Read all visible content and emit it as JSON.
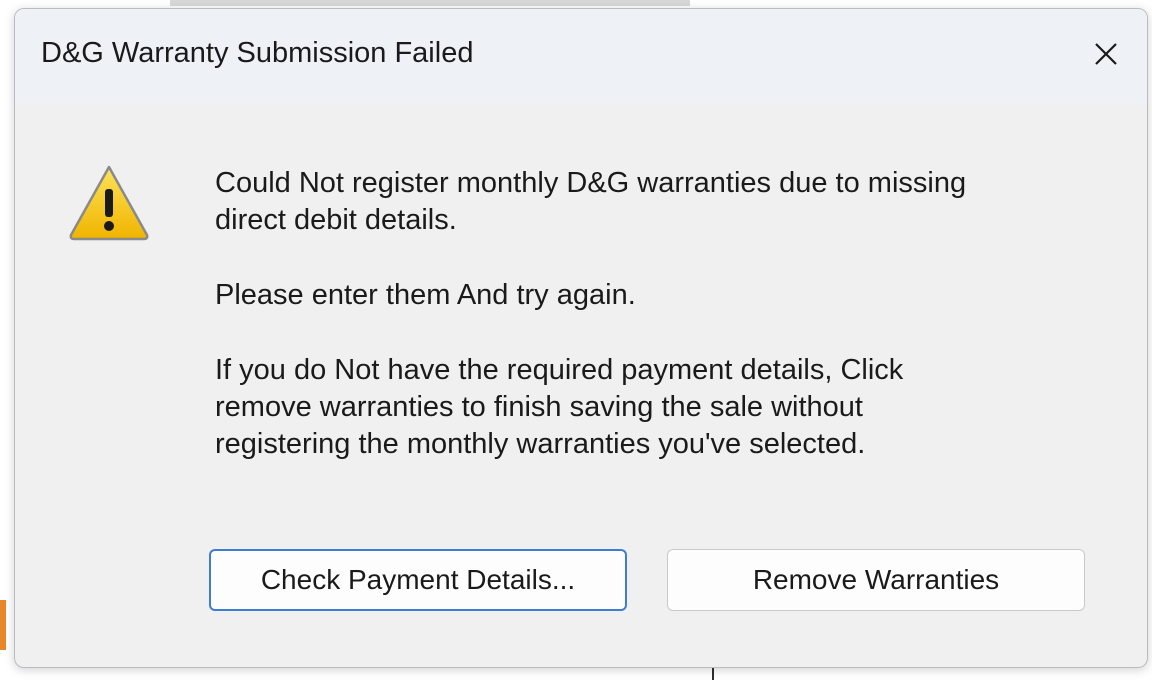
{
  "dialog": {
    "title": "D&G Warranty Submission Failed",
    "close_icon": "close-icon",
    "warning_icon": "warning-icon",
    "message_paragraphs": [
      "Could Not register monthly D&G warranties due to missing\ndirect debit details.",
      "Please enter them And try again.",
      "If you do Not have the required payment details, Click\nremove warranties to finish saving the sale without\nregistering the monthly warranties you've selected."
    ],
    "buttons": {
      "check_payment_label": "Check Payment Details...",
      "remove_warranties_label": "Remove Warranties"
    }
  },
  "colors": {
    "titlebar_bg": "#eef2f7",
    "dialog_bg": "#f0f0f0",
    "primary_border": "#3d7dd3",
    "warning_yellow": "#f5c400",
    "background_accent": "#e8862a"
  }
}
